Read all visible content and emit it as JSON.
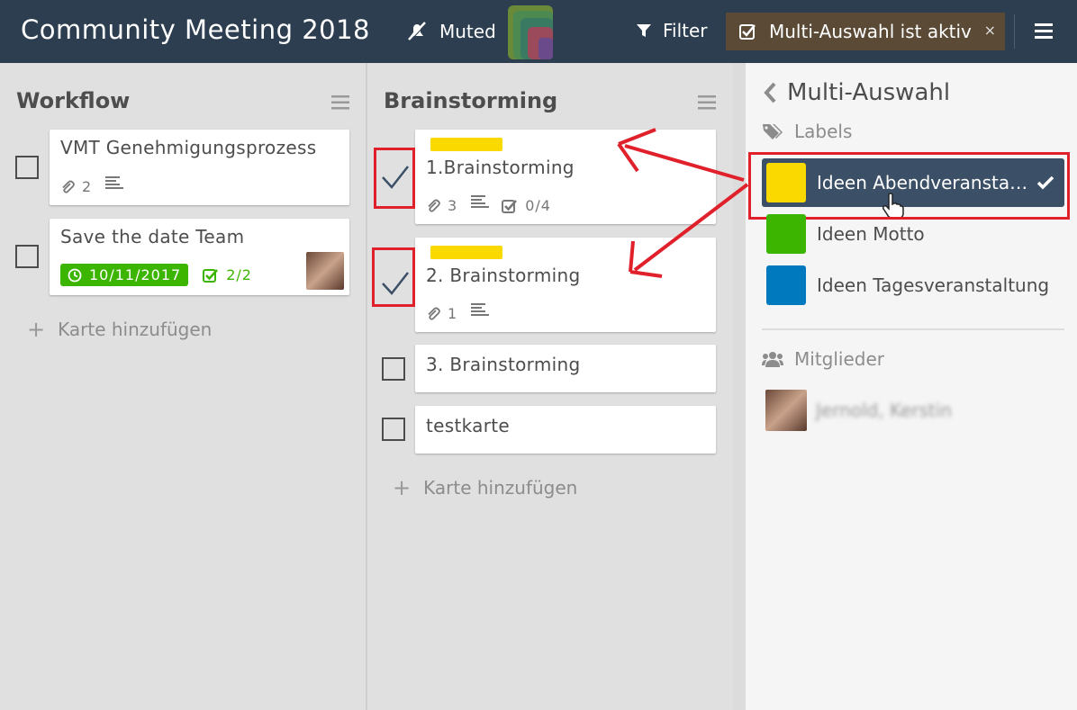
{
  "header": {
    "board_title": "Community Meeting 2018",
    "muted_label": "Muted",
    "filter_label": "Filter",
    "multiselect_label": "Multi-Auswahl ist aktiv",
    "close_symbol": "×",
    "colors": {
      "bg": "#2c3e50",
      "pill": "#5a4a36"
    }
  },
  "lists": [
    {
      "title": "Workflow",
      "cards": [
        {
          "title": "VMT Genehmigungsprozess",
          "attachments": "2",
          "has_description": true
        },
        {
          "title": "Save the date Team",
          "due": "10/11/2017",
          "checklist": "2/2",
          "has_member": true
        }
      ],
      "add_label": "Karte hinzufügen"
    },
    {
      "title": "Brainstorming",
      "cards": [
        {
          "title": "1.Brainstorming",
          "label_color": "#fad900",
          "attachments": "3",
          "has_description": true,
          "checklist": "0/4",
          "selected": true
        },
        {
          "title": "2. Brainstorming",
          "label_color": "#fad900",
          "attachments": "1",
          "has_description": true,
          "selected": true
        },
        {
          "title": "3. Brainstorming",
          "selected": false
        },
        {
          "title": "testkarte",
          "selected": false
        }
      ],
      "add_label": "Karte hinzufügen"
    }
  ],
  "sidebar": {
    "title": "Multi-Auswahl",
    "labels_heading": "Labels",
    "labels": [
      {
        "name": "Ideen Abendveranstaltung",
        "display": "Ideen Abendveransta…",
        "color": "#fad900",
        "active": true
      },
      {
        "name": "Ideen Motto",
        "display": "Ideen Motto",
        "color": "#3cb500",
        "active": false
      },
      {
        "name": "Ideen Tagesveranstaltung",
        "display": "Ideen Tagesveranstaltung",
        "color": "#0079bf",
        "active": false
      }
    ],
    "members_heading": "Mitglieder",
    "members": [
      {
        "name": "Jernold, Kerstin"
      }
    ]
  },
  "icons": {
    "muted": "bell-slash-icon",
    "filter": "filter-icon",
    "checkbox": "check-square-icon",
    "menu": "hamburger-icon",
    "attachment": "paperclip-icon",
    "description": "text-lines-icon",
    "clock": "clock-icon",
    "tags": "tags-icon",
    "users": "users-icon",
    "back": "chevron-left-icon",
    "plus": "plus-icon"
  }
}
